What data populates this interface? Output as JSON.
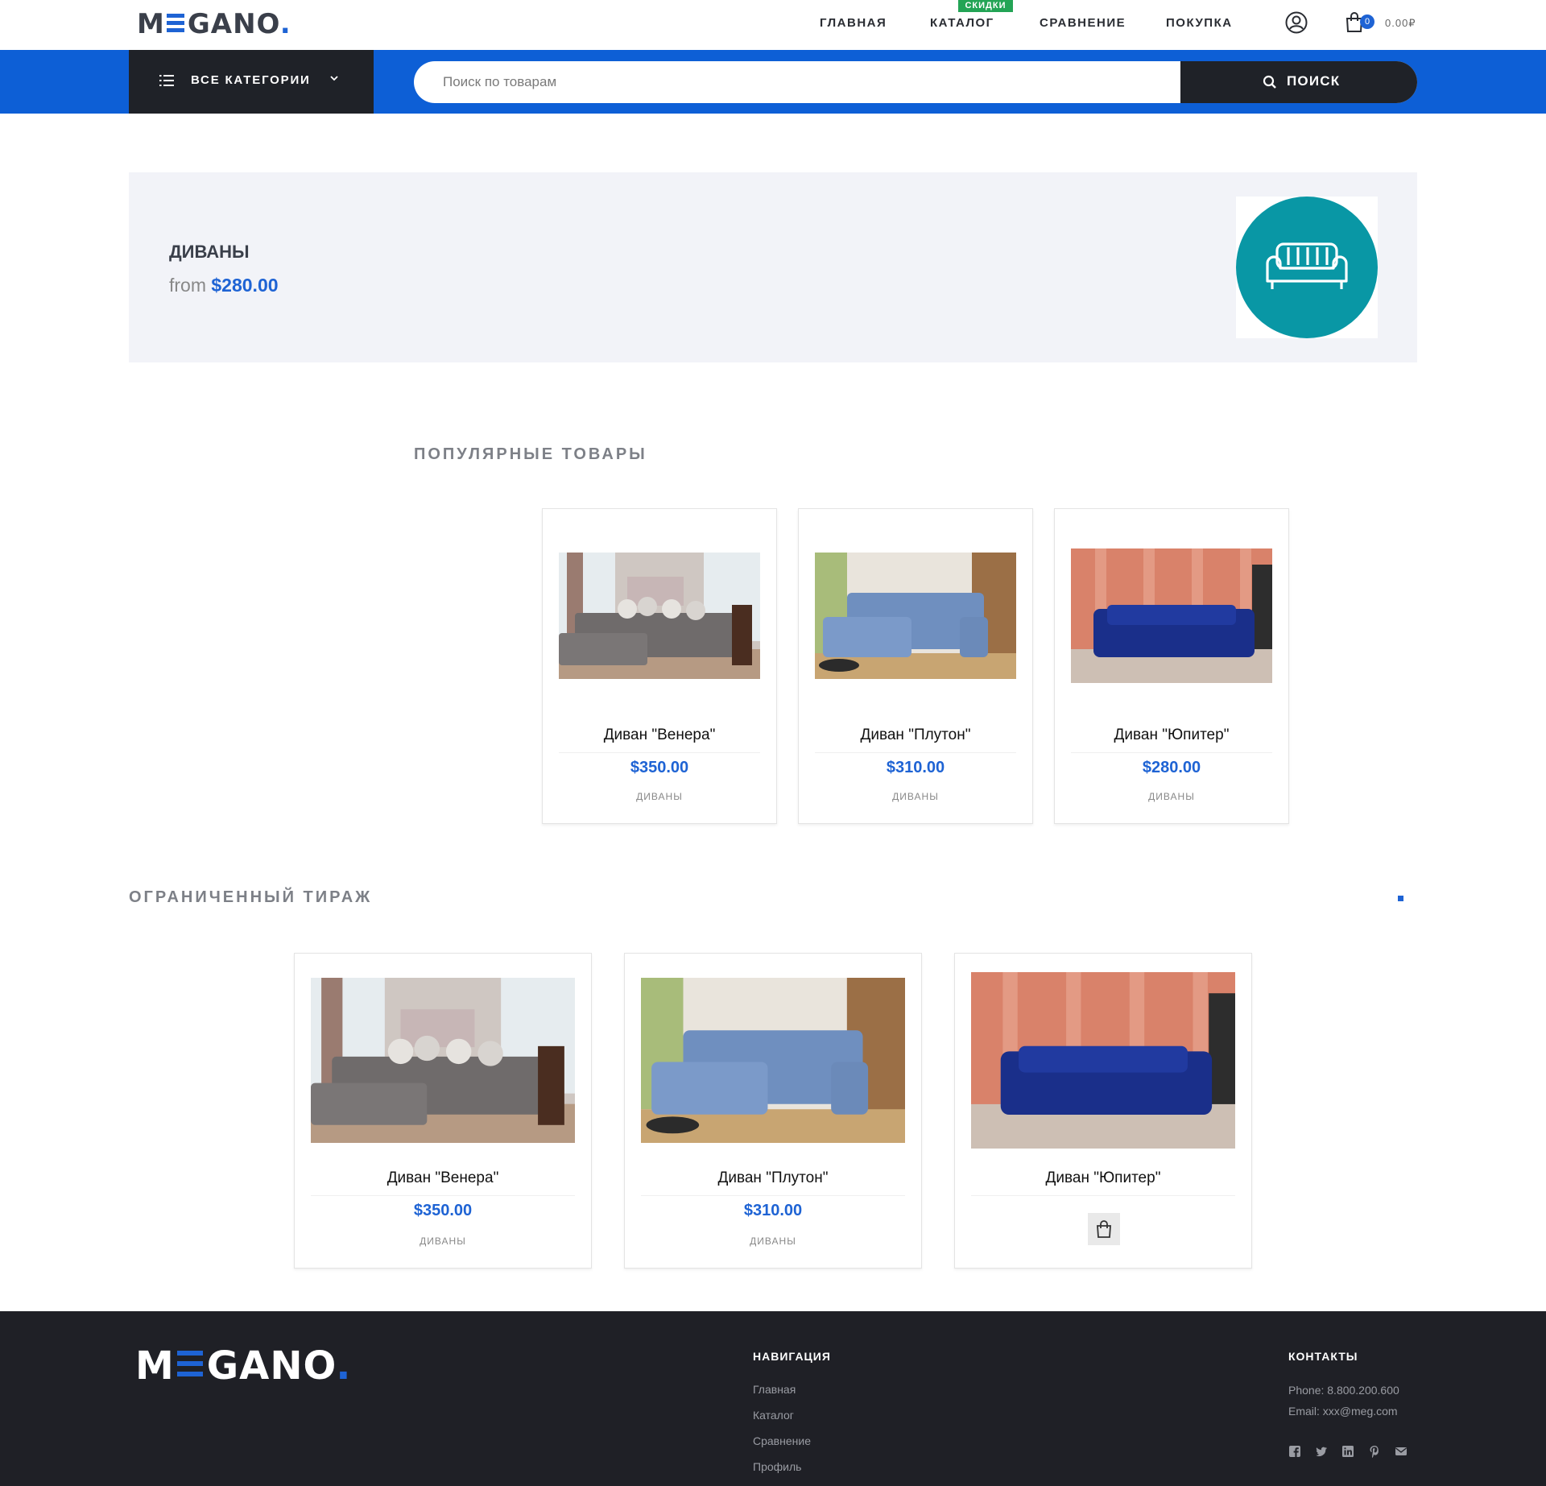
{
  "header": {
    "logo": {
      "pre": "M",
      "post": "GANO",
      "dot": "."
    },
    "nav": [
      {
        "label": "ГЛАВНАЯ"
      },
      {
        "label": "КАТАЛОГ",
        "badge": "СКИДКИ"
      },
      {
        "label": "СРАВНЕНИЕ"
      },
      {
        "label": "ПОКУПКА"
      }
    ],
    "cart_count": "0",
    "cart_total": "0.00₽"
  },
  "search": {
    "categories_label": "ВСЕ КАТЕГОРИИ",
    "placeholder": "Поиск по товарам",
    "button_label": "ПОИСК"
  },
  "banner": {
    "title": "ДИВАНЫ",
    "from_label": "from",
    "price": "$280.00",
    "icon": "sofa-icon"
  },
  "popular": {
    "title": "ПОПУЛЯРНЫЕ ТОВАРЫ",
    "items": [
      {
        "name": "Диван \"Венера\"",
        "price": "$350.00",
        "category": "ДИВАНЫ",
        "image": "grey-corner-sofa"
      },
      {
        "name": "Диван \"Плутон\"",
        "price": "$310.00",
        "category": "ДИВАНЫ",
        "image": "blue-corner-sofa"
      },
      {
        "name": "Диван \"Юпитер\"",
        "price": "$280.00",
        "category": "ДИВАНЫ",
        "image": "navy-sofa"
      }
    ]
  },
  "limited": {
    "title": "ОГРАНИЧЕННЫЙ ТИРАЖ",
    "items": [
      {
        "name": "Диван \"Венера\"",
        "price": "$350.00",
        "category": "ДИВАНЫ",
        "image": "grey-corner-sofa"
      },
      {
        "name": "Диван \"Плутон\"",
        "price": "$310.00",
        "category": "ДИВАНЫ",
        "image": "blue-corner-sofa"
      },
      {
        "name": "Диван \"Юпитер\"",
        "image": "navy-sofa",
        "action_icon": "shopping-bag-icon"
      }
    ]
  },
  "footer": {
    "logo": {
      "pre": "M",
      "post": "GANO",
      "dot": "."
    },
    "nav_title": "НАВИГАЦИЯ",
    "nav_links": [
      "Главная",
      "Каталог",
      "Сравнение",
      "Профиль"
    ],
    "contacts_title": "КОНТАКТЫ",
    "phone": "Phone: 8.800.200.600",
    "email": "Email: xxx@meg.com",
    "social": [
      "facebook-icon",
      "twitter-icon",
      "linkedin-icon",
      "pinterest-icon",
      "mail-icon"
    ]
  },
  "colors": {
    "accent": "#1e63d4",
    "dark": "#1f2228",
    "teal": "#0997a5",
    "sale": "#23a455"
  }
}
